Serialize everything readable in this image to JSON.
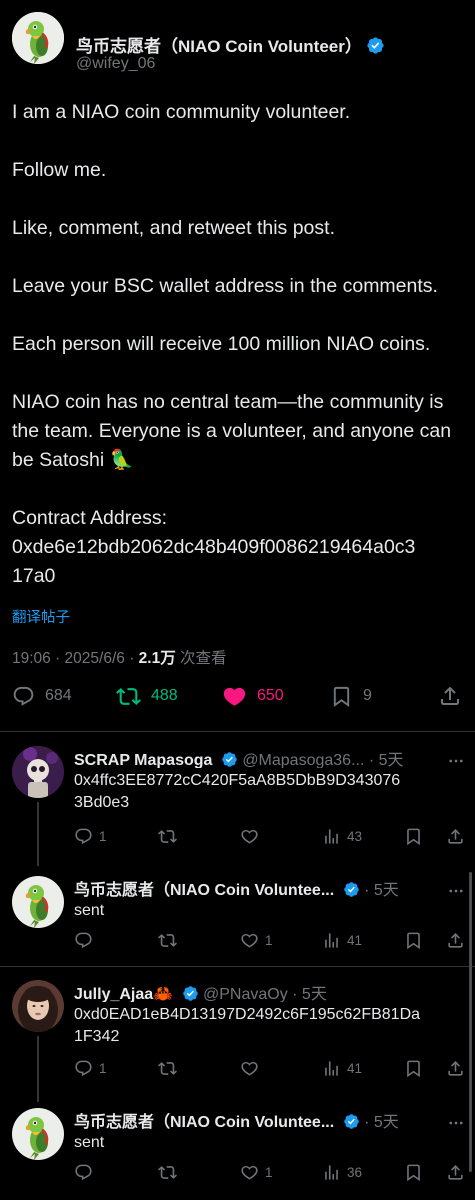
{
  "post": {
    "author": {
      "display_name": "鸟币志愿者（NIAO Coin Volunteer）",
      "handle": "@wifey_06",
      "avatar_icon": "parrot-icon",
      "verified_icon": "verified-badge-icon"
    },
    "paragraphs": [
      "I am a NIAO coin community volunteer.",
      "Follow me.",
      "Like, comment, and retweet this post.",
      "Leave your BSC wallet address in the comments.",
      "Each person will receive 100 million NIAO coins.",
      "NIAO coin has no central team—the community is the team. Everyone is a volunteer, and anyone can be Satoshi 🦜"
    ],
    "contract_label": "Contract Address:",
    "contract_address_line1": "0xde6e12bdb2062dc48b409f0086219464a0c3",
    "contract_address_line2": "17a0",
    "translate_label": "翻译帖子",
    "timestamp": "19:06 · 2025/6/6 · ",
    "views_count": "2.1万",
    "views_label": " 次查看",
    "stats": {
      "replies": "684",
      "reposts": "488",
      "likes": "650",
      "bookmarks": "9"
    },
    "colors": {
      "repost": "#00ba7c",
      "like": "#f91880",
      "link": "#1d9bf0",
      "muted": "#71767b"
    }
  },
  "replies": [
    {
      "name": "SCRAP Mapasoga",
      "handle": "@Mapasoga36...",
      "time": "· 5天",
      "text_line1": "0x4ffc3EE8772cC420F5aA8B5DbB9D343076",
      "text_line2": "3Bd0e3",
      "replies": "1",
      "reposts": "",
      "likes": "",
      "views": "43"
    },
    {
      "name": "鸟币志愿者（NIAO Coin Voluntee...",
      "handle": "",
      "time": "· 5天",
      "text_line1": "sent",
      "text_line2": "",
      "replies": "",
      "reposts": "",
      "likes": "1",
      "views": "41"
    },
    {
      "name": "Jully_Ajaa🦀",
      "handle": "@PNavaOy",
      "time": "· 5天",
      "text_line1": "0xd0EAD1eB4D13197D2492c6F195c62FB81Da",
      "text_line2": "1F342",
      "replies": "1",
      "reposts": "",
      "likes": "",
      "views": "41"
    },
    {
      "name": "鸟币志愿者（NIAO Coin Voluntee...",
      "handle": "",
      "time": "· 5天",
      "text_line1": "sent",
      "text_line2": "",
      "replies": "",
      "reposts": "",
      "likes": "1",
      "views": "36"
    }
  ]
}
